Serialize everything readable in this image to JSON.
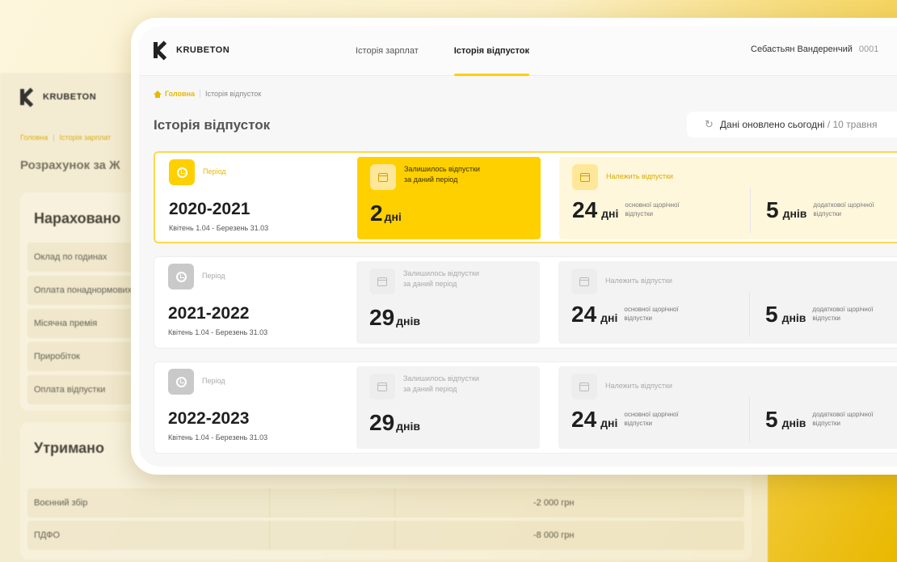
{
  "background": {
    "logo_text": "KRUBETON",
    "breadcrumb": {
      "home": "Головна",
      "current": "Історія зарплат"
    },
    "title": "Розрахунок за Ж",
    "accrued": {
      "title": "Нараховано",
      "rows": [
        "Оклад по годинах",
        "Оплата понаднормових",
        "Місячна премія",
        "Приробіток",
        "Оплата відпустки"
      ]
    },
    "withheld": {
      "title": "Утримано",
      "rows": [
        {
          "label": "Воєнний збір",
          "amount": "-2 000 грн"
        },
        {
          "label": "ПДФО",
          "amount": "-8 000 грн"
        }
      ]
    }
  },
  "header": {
    "logo_text": "KRUBETON",
    "nav": [
      "Історія зарплат",
      "Історія відпусток"
    ],
    "active_tab": 1,
    "user_name": "Себастьян Вандеренчий",
    "user_id": "0001"
  },
  "breadcrumb": {
    "home": "Головна",
    "current": "Історія відпусток"
  },
  "page_title": "Історія відпусток",
  "refresh": {
    "text": "Дані оновлено сьогодні",
    "date": "/ 10 травня"
  },
  "labels": {
    "period": "Період",
    "remaining_line1": "Залишилось відпустки",
    "remaining_line2": "за даний період",
    "entitled": "Належить відпустки",
    "main_desc_line1": "основної щорічної",
    "main_desc_line2": "відпустки",
    "extra_desc_line1": "додаткової щорічної",
    "extra_desc_line2": "відпустки"
  },
  "periods": [
    {
      "years": "2020-2021",
      "range": "Квітень 1.04 - Березень 31.03",
      "remaining": "2",
      "remaining_unit": "дні",
      "main_days": "24",
      "main_unit": "дні",
      "extra_days": "5",
      "extra_unit": "днів",
      "active": true
    },
    {
      "years": "2021-2022",
      "range": "Квітень 1.04 - Березень 31.03",
      "remaining": "29",
      "remaining_unit": "днів",
      "main_days": "24",
      "main_unit": "дні",
      "extra_days": "5",
      "extra_unit": "днів",
      "active": false
    },
    {
      "years": "2022-2023",
      "range": "Квітень 1.04 - Березень 31.03",
      "remaining": "29",
      "remaining_unit": "днів",
      "main_days": "24",
      "main_unit": "дні",
      "extra_days": "5",
      "extra_unit": "днів",
      "active": false
    }
  ],
  "colors": {
    "accent": "#ffd000",
    "accent_text": "#e9b800"
  }
}
